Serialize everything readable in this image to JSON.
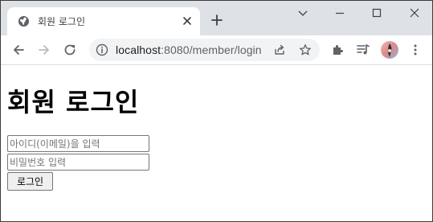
{
  "browser": {
    "tab": {
      "title": "회원 로그인",
      "favicon": "globe-icon"
    },
    "address_bar": {
      "host": "localhost",
      "path": ":8080/member/login"
    },
    "window_controls": [
      "chevron-down-icon",
      "minimize-icon",
      "maximize-icon",
      "close-icon"
    ],
    "toolbar_icons": [
      "back-arrow-icon",
      "forward-arrow-icon",
      "reload-icon",
      "info-icon",
      "share-icon",
      "star-icon",
      "extensions-icon",
      "media-queue-icon",
      "profile-avatar",
      "more-menu-icon"
    ]
  },
  "page": {
    "title": "회원 로그인",
    "form": {
      "id_placeholder": "아이디(이메일)을 입력",
      "id_value": "",
      "password_placeholder": "비밀번호 입력",
      "password_value": "",
      "submit_label": "로그인"
    }
  },
  "colors": {
    "tabstrip": "#dee1e6",
    "omnibox": "#f1f3f4",
    "icon": "#5f6368",
    "disabled_icon": "#b9bcbf"
  }
}
